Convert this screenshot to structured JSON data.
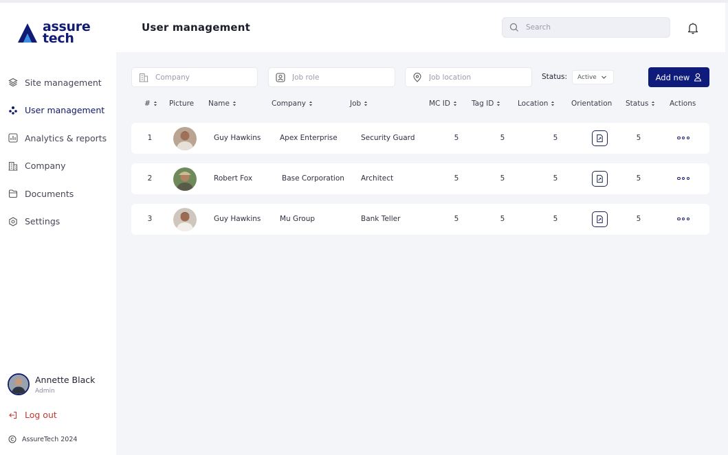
{
  "app": {
    "logo_line1": "assure",
    "logo_line2": "tech",
    "brand_color": "#101b73"
  },
  "sidebar": {
    "items": [
      {
        "label": "Site management",
        "icon": "layers-icon"
      },
      {
        "label": "User management",
        "icon": "users-icon",
        "active": true
      },
      {
        "label": "Analytics & reports",
        "icon": "chart-icon"
      },
      {
        "label": "Company",
        "icon": "building-icon"
      },
      {
        "label": "Documents",
        "icon": "folder-icon"
      },
      {
        "label": "Settings",
        "icon": "gear-icon"
      }
    ],
    "profile": {
      "name": "Annette Black",
      "role": "Admin"
    },
    "logout": "Log out",
    "copyright": "AssureTech 2024"
  },
  "header": {
    "title": "User management",
    "search_placeholder": "Search"
  },
  "filters": {
    "company_placeholder": "Company",
    "job_role_placeholder": "Job role",
    "job_location_placeholder": "Job location",
    "status_label": "Status:",
    "status_value": "Active",
    "add_button": "Add new"
  },
  "table": {
    "columns": [
      "#",
      "Picture",
      "Name",
      "Company",
      "Job",
      "MC ID",
      "Tag ID",
      "Location",
      "Orientation",
      "Status",
      "Actions"
    ],
    "rows": [
      {
        "index": "1",
        "name": "Guy Hawkins",
        "company": "Apex Enterprise",
        "job": "Security Guard",
        "mc_id": "5",
        "tag_id": "5",
        "location": "5",
        "status": "5"
      },
      {
        "index": "2",
        "name": "Robert Fox",
        "company": "Base Corporation",
        "job": "Architect",
        "mc_id": "5",
        "tag_id": "5",
        "location": "5",
        "status": "5"
      },
      {
        "index": "3",
        "name": "Guy Hawkins",
        "company": "Mu Group",
        "job": "Bank Teller",
        "mc_id": "5",
        "tag_id": "5",
        "location": "5",
        "status": "5"
      }
    ]
  }
}
